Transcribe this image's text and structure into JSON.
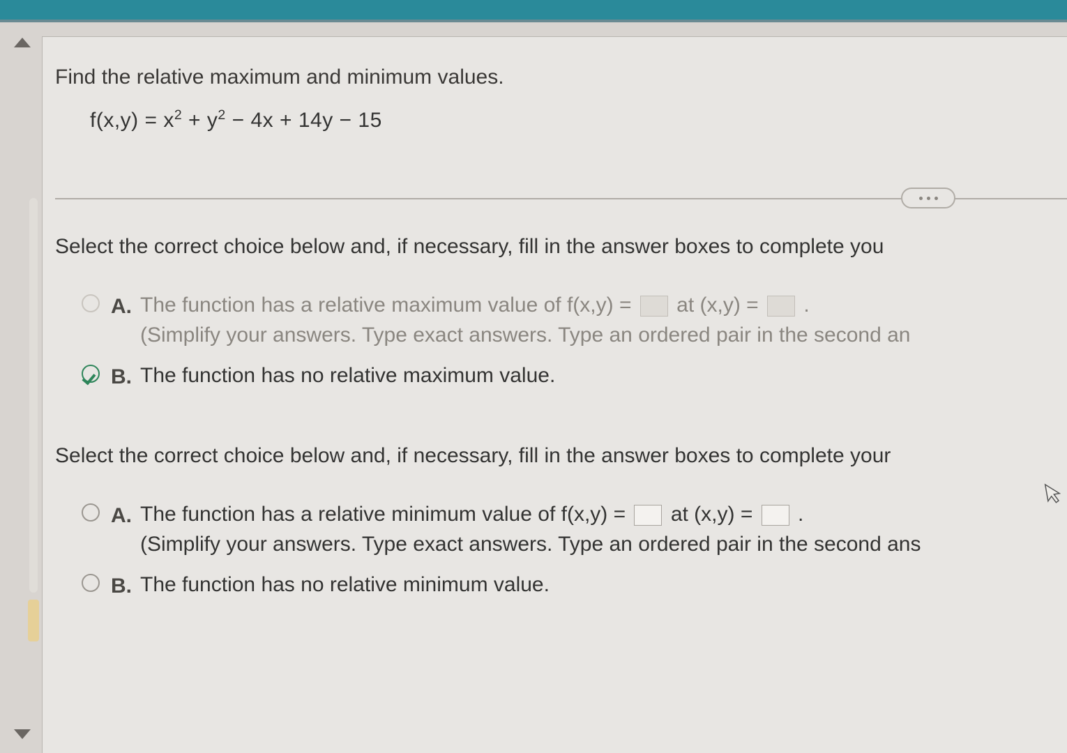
{
  "question": {
    "prompt": "Find the relative maximum and minimum values.",
    "formula_prefix": "f(x,y) = x",
    "formula_mid1": " + y",
    "formula_mid2": " − 4x + 14y − 15",
    "exp": "2"
  },
  "divider": {
    "symbol": "..."
  },
  "part1": {
    "instruction": "Select the correct choice below and, if necessary, fill in the answer boxes to complete you",
    "optionA": {
      "letter": "A.",
      "text_a": "The function has a relative maximum value of f(x,y) =",
      "text_b": "at (x,y) =",
      "text_c": ".",
      "hint": "(Simplify your answers. Type exact answers. Type an ordered pair in the second an"
    },
    "optionB": {
      "letter": "B.",
      "text": "The function has no relative maximum value."
    },
    "selected": "B"
  },
  "part2": {
    "instruction": "Select the correct choice below and, if necessary, fill in the answer boxes to complete your",
    "optionA": {
      "letter": "A.",
      "text_a": "The function has a relative minimum value of f(x,y) =",
      "text_b": "at (x,y) =",
      "text_c": ".",
      "hint": "(Simplify your answers. Type exact answers. Type an ordered pair in the second ans"
    },
    "optionB": {
      "letter": "B.",
      "text": "The function has no relative minimum value."
    },
    "selected": null
  }
}
